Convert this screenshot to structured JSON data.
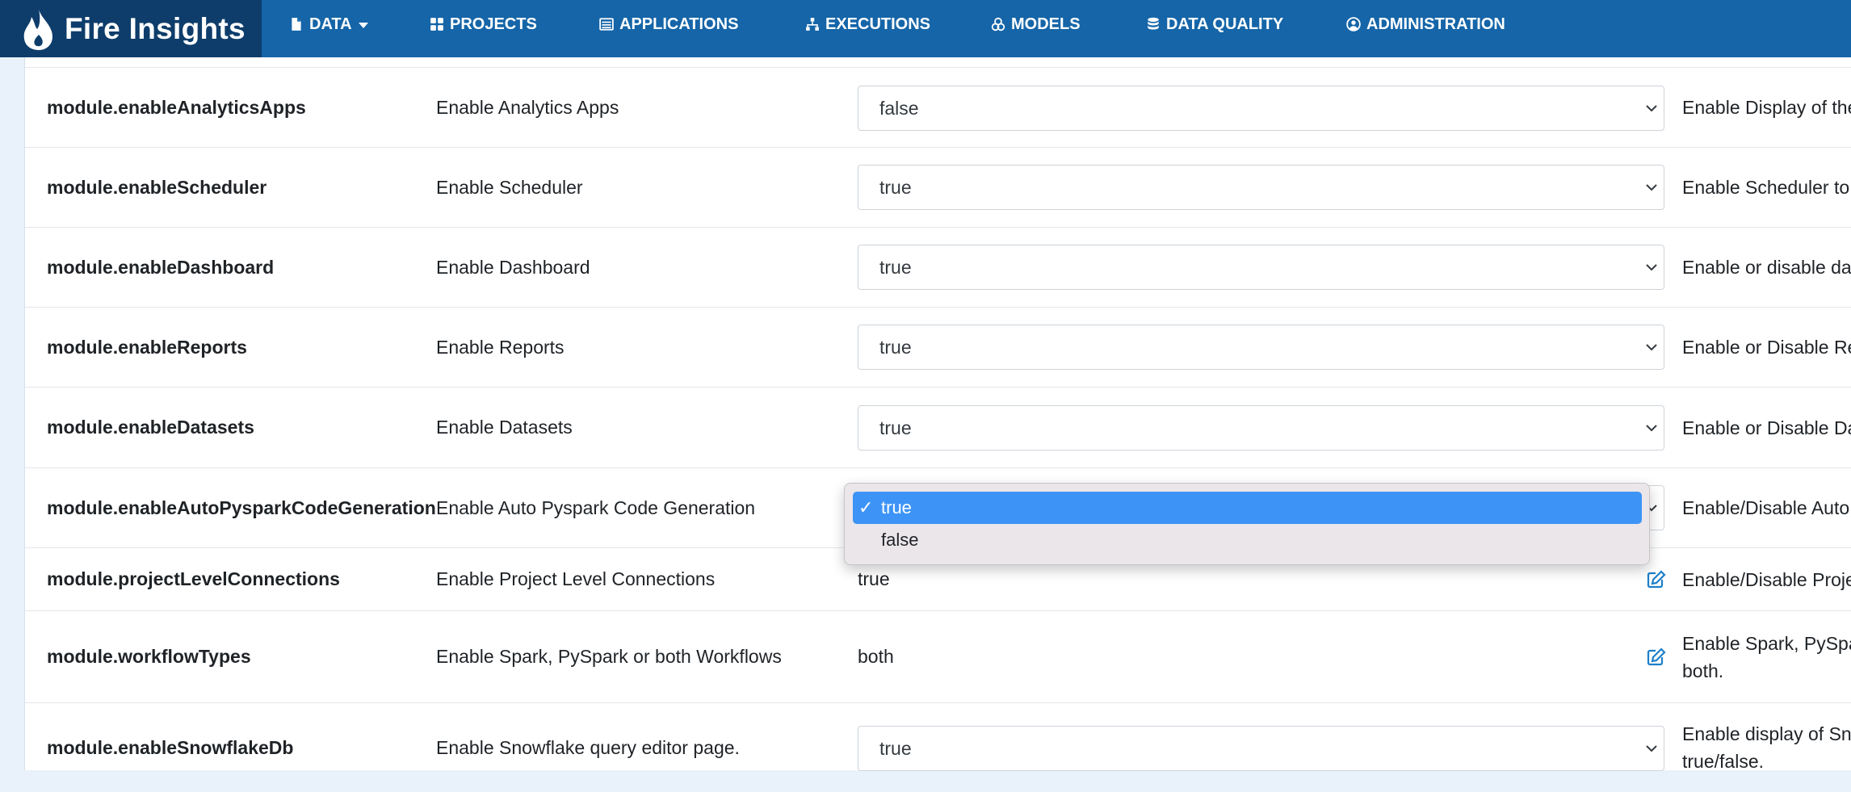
{
  "app": {
    "name": "Fire Insights"
  },
  "nav": [
    {
      "label": "DATA",
      "icon": "file-icon",
      "has_caret": true
    },
    {
      "label": "PROJECTS",
      "icon": "grid-icon"
    },
    {
      "label": "APPLICATIONS",
      "icon": "list-icon"
    },
    {
      "label": "EXECUTIONS",
      "icon": "sitemap-icon"
    },
    {
      "label": "MODELS",
      "icon": "cubes-icon"
    },
    {
      "label": "DATA QUALITY",
      "icon": "database-icon"
    },
    {
      "label": "ADMINISTRATION",
      "icon": "user-circle-icon"
    }
  ],
  "rows": [
    {
      "key": "module.enableAnalyticsApps",
      "label": "Enable Analytics Apps",
      "value": "false",
      "control": "select",
      "desc": "Enable Display of the"
    },
    {
      "key": "module.enableScheduler",
      "label": "Enable Scheduler",
      "value": "true",
      "control": "select",
      "desc": "Enable Scheduler to"
    },
    {
      "key": "module.enableDashboard",
      "label": "Enable Dashboard",
      "value": "true",
      "control": "select",
      "desc": "Enable or disable da"
    },
    {
      "key": "module.enableReports",
      "label": "Enable Reports",
      "value": "true",
      "control": "select",
      "desc": "Enable or Disable Re"
    },
    {
      "key": "module.enableDatasets",
      "label": "Enable Datasets",
      "value": "true",
      "control": "select",
      "desc": "Enable or Disable Da"
    },
    {
      "key": "module.enableAutoPysparkCodeGeneration",
      "label": "Enable Auto Pyspark Code Generation",
      "value": "true",
      "control": "select-open",
      "desc": "Enable/Disable Auto"
    },
    {
      "key": "module.projectLevelConnections",
      "label": "Enable Project Level Connections",
      "value": "true",
      "control": "text",
      "desc": "Enable/Disable Proje"
    },
    {
      "key": "module.workflowTypes",
      "label": "Enable Spark, PySpark or both Workflows",
      "value": "both",
      "control": "text",
      "desc": "Enable Spark, PySpa",
      "desc2": "both."
    },
    {
      "key": "module.enableSnowflakeDb",
      "label": "Enable Snowflake query editor page.",
      "value": "true",
      "control": "select",
      "desc": "Enable display of Sn",
      "desc2": "true/false."
    }
  ],
  "dropdown": {
    "options": [
      {
        "label": "true",
        "selected": true,
        "check": "✓"
      },
      {
        "label": "false",
        "selected": false,
        "check": ""
      }
    ]
  },
  "colors": {
    "navbar": "#1565a8",
    "brand_bg": "#0e3d6b",
    "selected_option": "#3d94f6",
    "edit_icon": "#1d7fc9"
  }
}
